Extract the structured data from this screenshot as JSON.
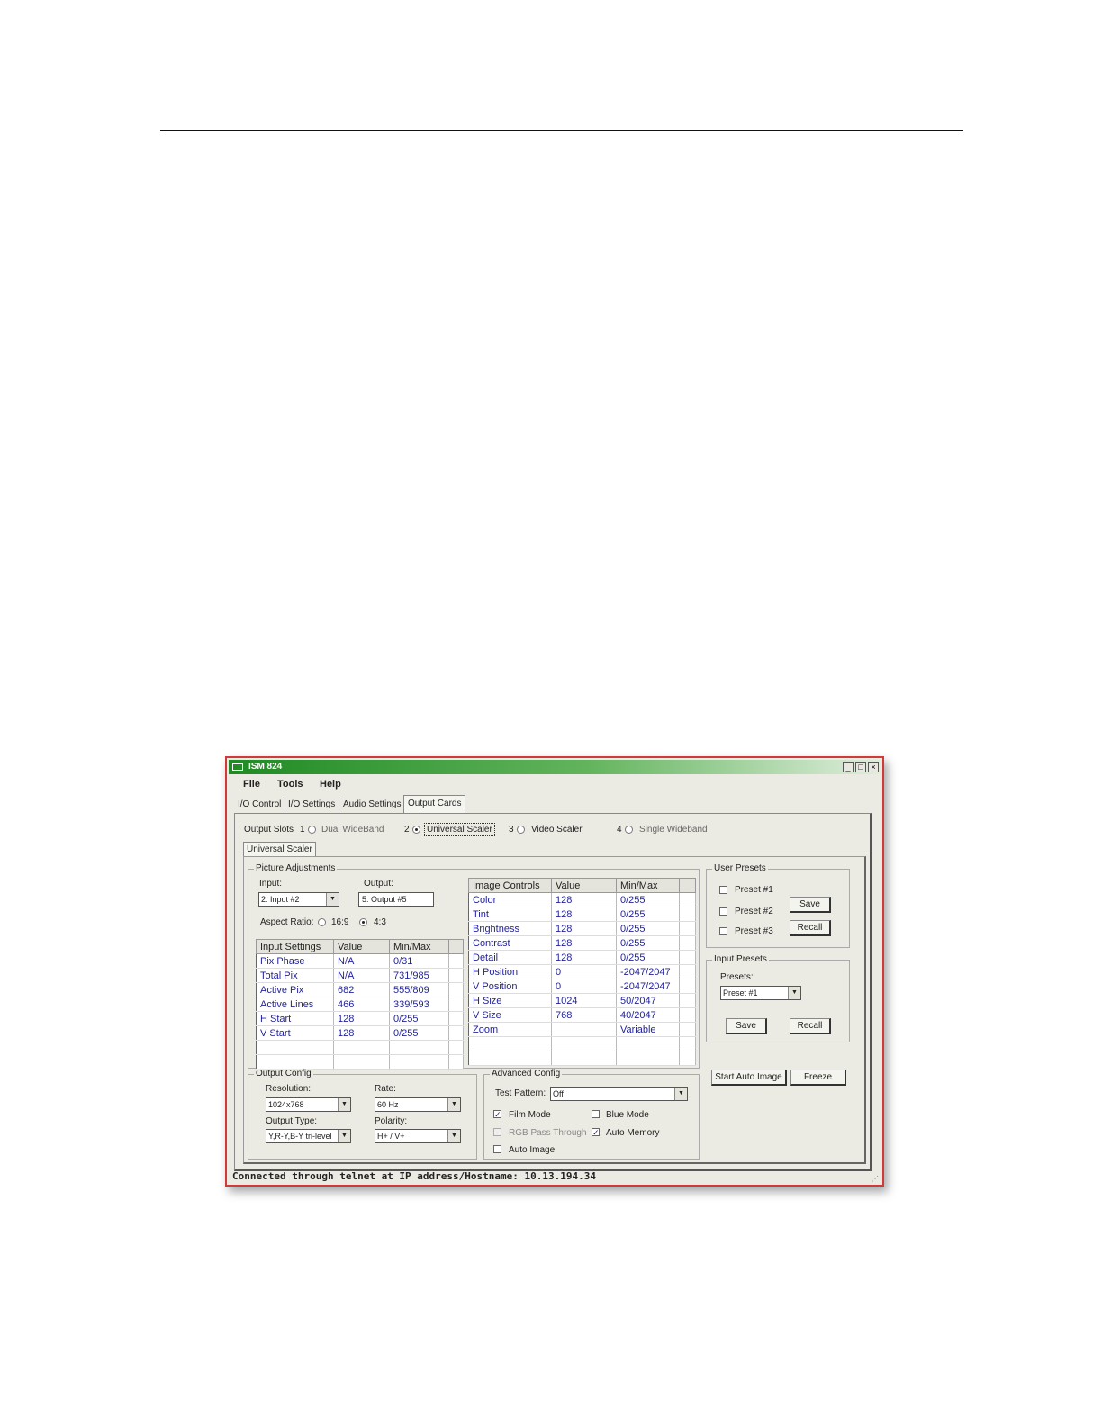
{
  "window": {
    "title": "ISM 824"
  },
  "menu": [
    "File",
    "Tools",
    "Help"
  ],
  "tabs": [
    "I/O Control",
    "I/O Settings",
    "Audio Settings",
    "Output Cards"
  ],
  "output_slots": {
    "label": "Output Slots",
    "slots": [
      {
        "num": "1",
        "name": "Dual WideBand"
      },
      {
        "num": "2",
        "name": "Universal Scaler"
      },
      {
        "num": "3",
        "name": "Video Scaler"
      },
      {
        "num": "4",
        "name": "Single Wideband"
      }
    ]
  },
  "subtab": "Universal Scaler",
  "picture_adjustments": {
    "title": "Picture Adjustments",
    "input_label": "Input:",
    "input_value": "2: Input #2",
    "output_label": "Output:",
    "output_value": "5: Output #5",
    "aspect_label": "Aspect Ratio:",
    "aspect_options": [
      "16:9",
      "4:3"
    ]
  },
  "input_settings": {
    "headers": [
      "Input Settings",
      "Value",
      "Min/Max"
    ],
    "rows": [
      [
        "Pix Phase",
        "N/A",
        "0/31"
      ],
      [
        "Total Pix",
        "N/A",
        "731/985"
      ],
      [
        "Active Pix",
        "682",
        "555/809"
      ],
      [
        "Active Lines",
        "466",
        "339/593"
      ],
      [
        "H Start",
        "128",
        "0/255"
      ],
      [
        "V Start",
        "128",
        "0/255"
      ]
    ]
  },
  "image_controls": {
    "headers": [
      "Image Controls",
      "Value",
      "Min/Max"
    ],
    "rows": [
      [
        "Color",
        "128",
        "0/255"
      ],
      [
        "Tint",
        "128",
        "0/255"
      ],
      [
        "Brightness",
        "128",
        "0/255"
      ],
      [
        "Contrast",
        "128",
        "0/255"
      ],
      [
        "Detail",
        "128",
        "0/255"
      ],
      [
        "H Position",
        "0",
        "-2047/2047"
      ],
      [
        "V Position",
        "0",
        "-2047/2047"
      ],
      [
        "H Size",
        "1024",
        "50/2047"
      ],
      [
        "V Size",
        "768",
        "40/2047"
      ],
      [
        "Zoom",
        "",
        "Variable"
      ]
    ]
  },
  "user_presets": {
    "title": "User Presets",
    "items": [
      "Preset #1",
      "Preset #2",
      "Preset #3"
    ],
    "save": "Save",
    "recall": "Recall"
  },
  "input_presets": {
    "title": "Input Presets",
    "label": "Presets:",
    "value": "Preset #1",
    "save": "Save",
    "recall": "Recall"
  },
  "actions": {
    "auto_image": "Start Auto Image",
    "freeze": "Freeze"
  },
  "output_config": {
    "title": "Output Config",
    "resolution_label": "Resolution:",
    "resolution": "1024x768",
    "rate_label": "Rate:",
    "rate": "60 Hz",
    "type_label": "Output Type:",
    "type": "Y,R-Y,B-Y tri-level",
    "polarity_label": "Polarity:",
    "polarity": "H+ / V+"
  },
  "advanced_config": {
    "title": "Advanced Config",
    "test_pattern_label": "Test Pattern:",
    "test_pattern": "Off",
    "film_mode": "Film Mode",
    "blue_mode": "Blue Mode",
    "rgb_pass": "RGB Pass Through",
    "auto_memory": "Auto Memory",
    "auto_image": "Auto Image"
  },
  "status": "Connected through telnet at IP address/Hostname: 10.13.194.34"
}
